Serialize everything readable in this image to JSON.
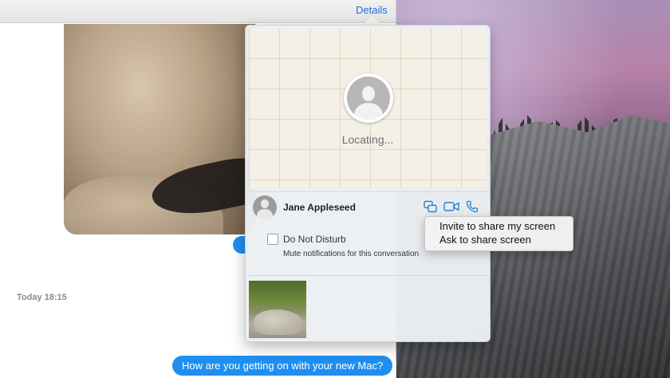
{
  "window": {
    "details_link": "Details"
  },
  "conversation": {
    "timestamp": "Today 18:15",
    "outgoing_message": "How are you getting on with your new Mac?"
  },
  "details_popover": {
    "map": {
      "status_text": "Locating..."
    },
    "contact": {
      "name": "Jane Appleseed",
      "actions": [
        "screen-share-icon",
        "video-camera-icon",
        "phone-icon"
      ]
    },
    "do_not_disturb": {
      "label": "Do Not Disturb",
      "checked": false,
      "description": "Mute notifications for this conversation"
    }
  },
  "screen_share_menu": {
    "items": [
      {
        "label": "Invite to share my screen"
      },
      {
        "label": "Ask to share screen"
      }
    ]
  },
  "colors": {
    "accent_blue": "#1e8ff0",
    "link_blue": "#1f6fd6",
    "icon_blue": "#2a7fd4"
  }
}
